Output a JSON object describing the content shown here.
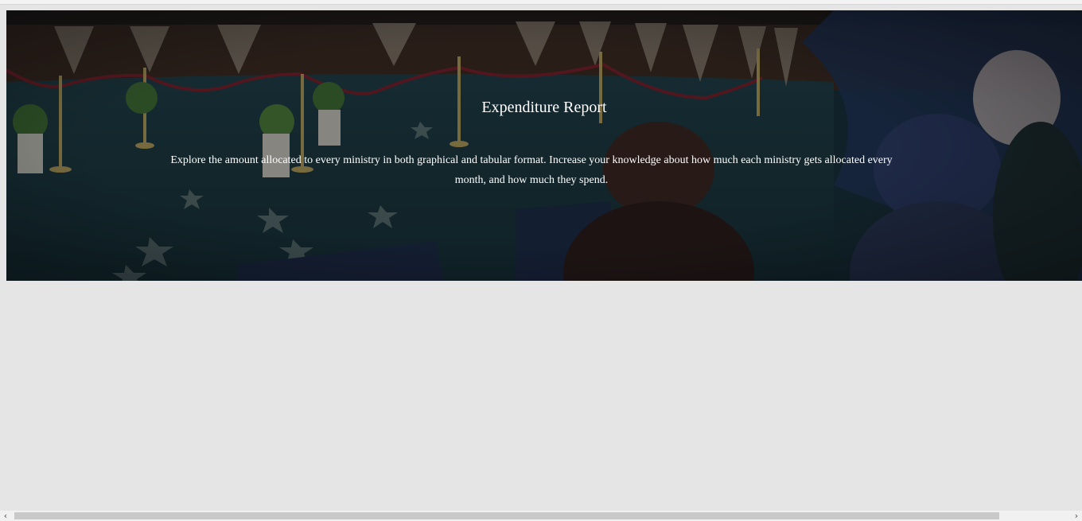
{
  "hero": {
    "title": "Expenditure Report",
    "description": "Explore the amount allocated to every ministry in both graphical and tabular format. Increase your knowledge about how much each ministry gets allocated every month, and how much they spend."
  },
  "scrollbar": {
    "left_arrow": "‹",
    "right_arrow": "›"
  },
  "colors": {
    "page_background": "#e5e5e5",
    "hero_overlay": "#0c1a20",
    "text": "#ffffff"
  }
}
